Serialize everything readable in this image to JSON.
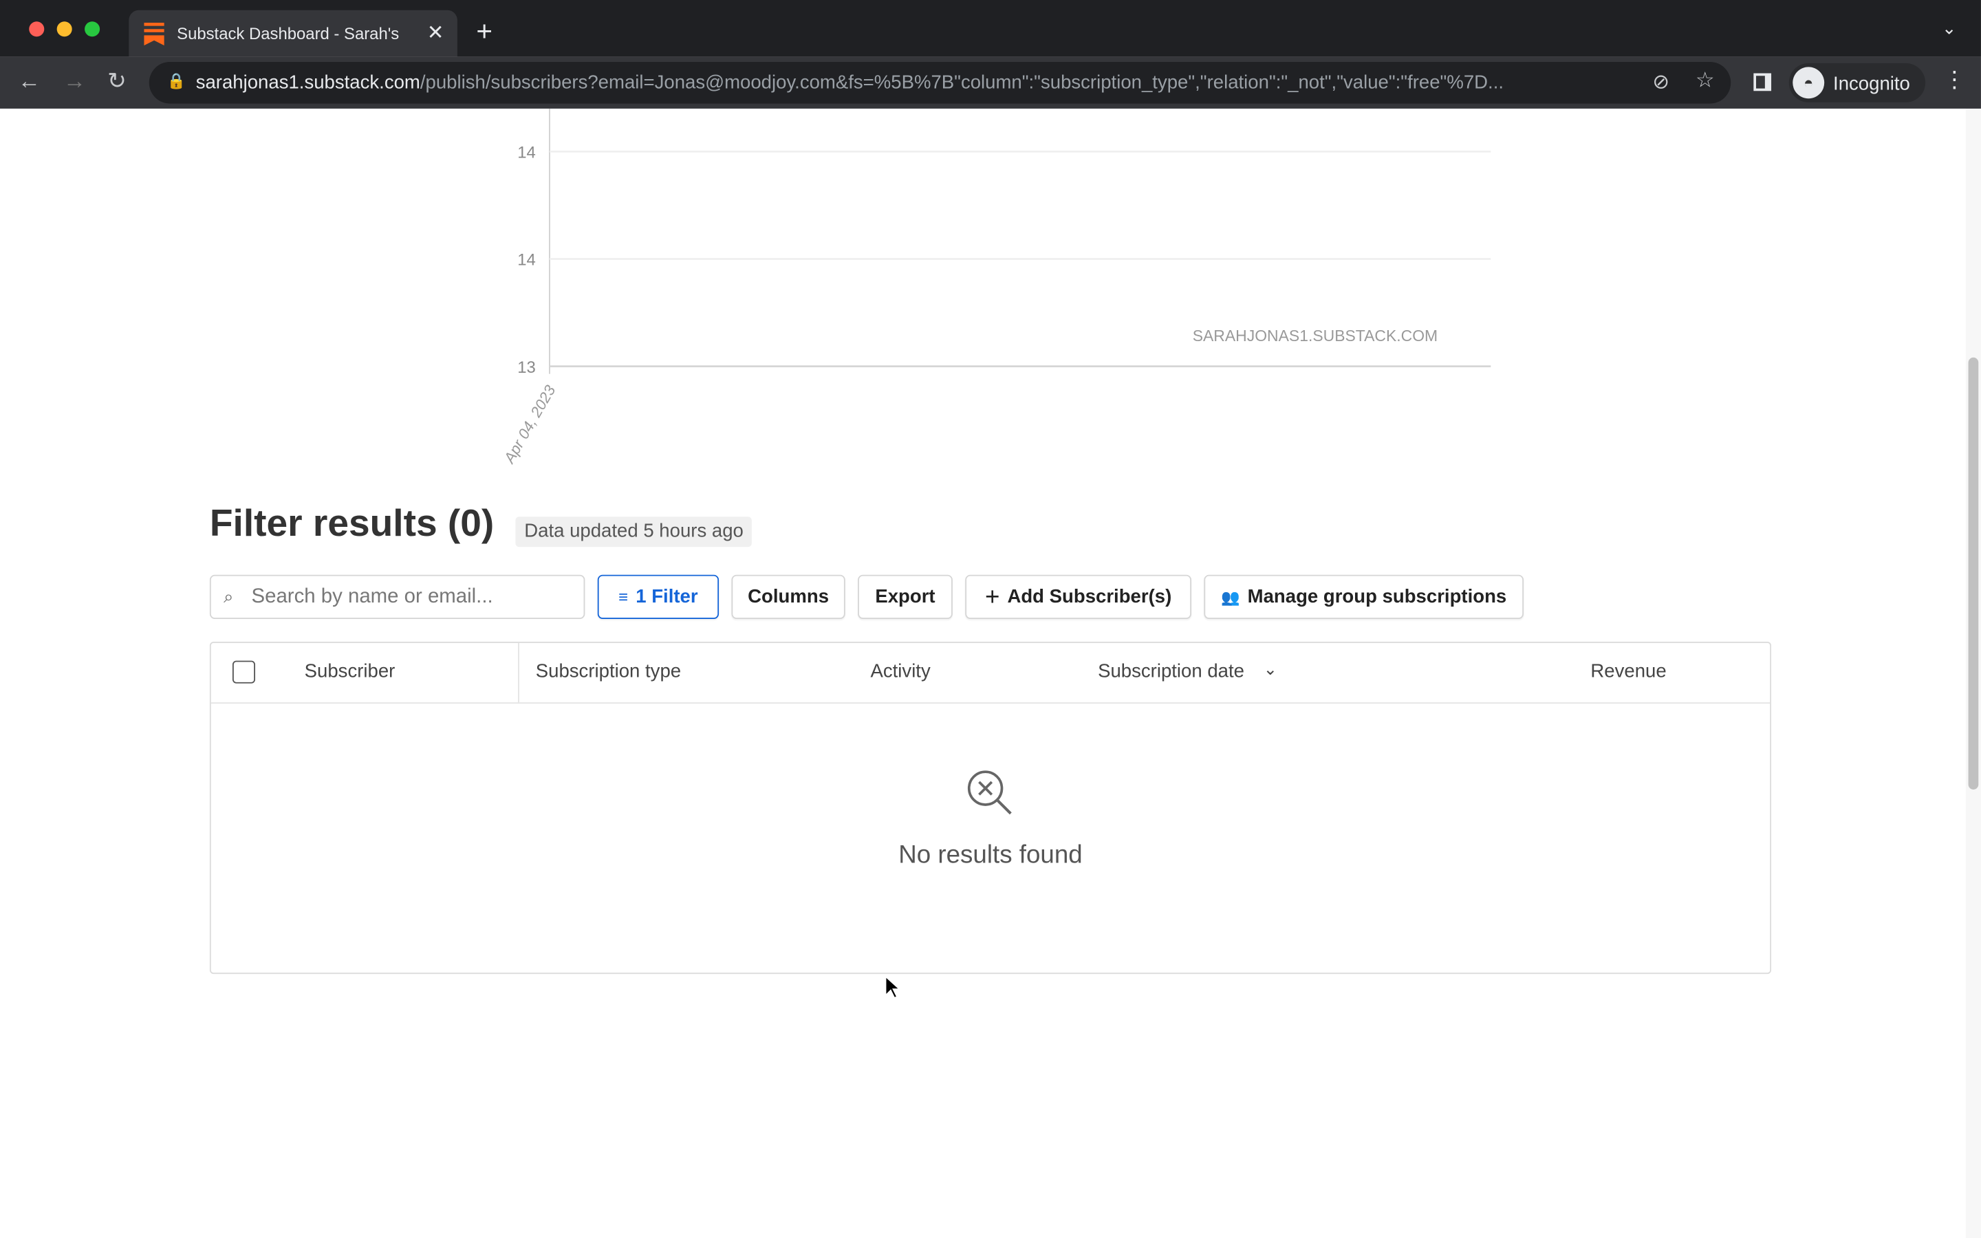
{
  "browser": {
    "tab_title": "Substack Dashboard - Sarah's",
    "url_host": "sarahjonas1.substack.com",
    "url_path": "/publish/subscribers?email=Jonas@moodjoy.com&fs=%5B%7B\"column\":\"subscription_type\",\"relation\":\"_not\",\"value\":\"free\"%7D...",
    "profile_label": "Incognito",
    "accent": "#ff6719"
  },
  "chart_data": {
    "type": "line",
    "x_tick_labels": [
      "Apr 04, 2023"
    ],
    "y_tick_labels": [
      "14",
      "14",
      "13"
    ],
    "series": [],
    "watermark": "SARAHJONAS1.SUBSTACK.COM",
    "grid": true
  },
  "results": {
    "title": "Filter results (0)",
    "updated_badge": "Data updated 5 hours ago",
    "search_placeholder": "Search by name or email...",
    "filter_label": "1 Filter",
    "columns_label": "Columns",
    "export_label": "Export",
    "add_label": "Add Subscriber(s)",
    "manage_label": "Manage group subscriptions",
    "filter_color": "#1565d8",
    "columns": [
      "Subscriber",
      "Subscription type",
      "Activity",
      "Subscription date",
      "Revenue"
    ],
    "empty_text": "No results found"
  }
}
